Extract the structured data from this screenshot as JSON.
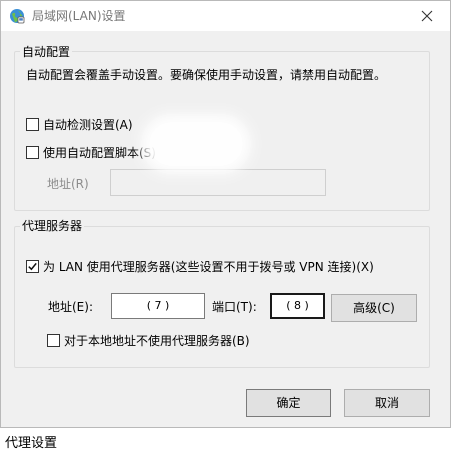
{
  "window": {
    "title": "局域网(LAN)设置",
    "icon": "network-globe-icon"
  },
  "auto_config": {
    "group_title": "自动配置",
    "description": "自动配置会覆盖手动设置。要确保使用手动设置，请禁用自动配置。",
    "auto_detect": {
      "label": "自动检测设置(A)",
      "checked": false
    },
    "use_script": {
      "label": "使用自动配置脚本(S)",
      "checked": false
    },
    "address_label": "地址(R)",
    "address_value": ""
  },
  "proxy": {
    "group_title": "代理服务器",
    "use_proxy": {
      "label": "为 LAN 使用代理服务器(这些设置不用于拨号或 VPN 连接)(X)",
      "checked": true
    },
    "address_label": "地址(E):",
    "address_value": "( 7 )",
    "port_label": "端口(T):",
    "port_value": "( 8 )",
    "advanced_label": "高级(C)",
    "bypass_local": {
      "label": "对于本地地址不使用代理服务器(B)",
      "checked": false
    }
  },
  "buttons": {
    "ok": "确定",
    "cancel": "取消"
  },
  "caption": "代理设置"
}
